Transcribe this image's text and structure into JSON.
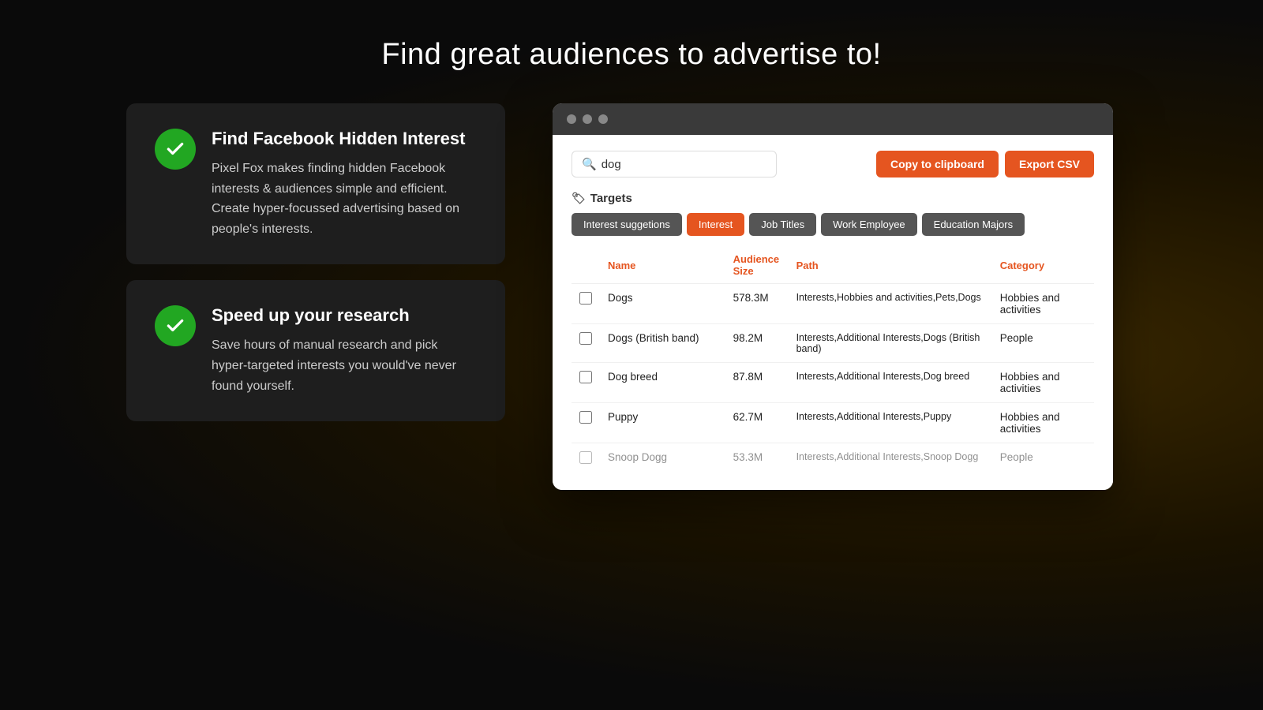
{
  "page": {
    "title": "Find great audiences to advertise to!"
  },
  "features": [
    {
      "id": "feature-1",
      "heading": "Find Facebook Hidden Interest",
      "body": "Pixel Fox makes finding hidden Facebook interests & audiences simple and efficient. Create hyper-focussed advertising based on people's interests."
    },
    {
      "id": "feature-2",
      "heading": "Speed up your research",
      "body": "Save hours of manual research and pick hyper-targeted interests you would've never found yourself."
    }
  ],
  "window": {
    "dots": [
      "dot1",
      "dot2",
      "dot3"
    ]
  },
  "toolbar": {
    "search_value": "dog",
    "copy_label": "Copy to clipboard",
    "export_label": "Export CSV"
  },
  "targets": {
    "label": "Targets",
    "tabs": [
      {
        "id": "interest-suggestions",
        "label": "Interest suggetions",
        "state": "inactive"
      },
      {
        "id": "interest",
        "label": "Interest",
        "state": "active"
      },
      {
        "id": "job-titles",
        "label": "Job Titles",
        "state": "inactive"
      },
      {
        "id": "work-employee",
        "label": "Work Employee",
        "state": "inactive"
      },
      {
        "id": "education-majors",
        "label": "Education Majors",
        "state": "inactive"
      }
    ]
  },
  "table": {
    "columns": [
      {
        "id": "check",
        "label": ""
      },
      {
        "id": "name",
        "label": "Name"
      },
      {
        "id": "size",
        "label": "Audience Size"
      },
      {
        "id": "path",
        "label": "Path"
      },
      {
        "id": "category",
        "label": "Category"
      }
    ],
    "rows": [
      {
        "name": "Dogs",
        "size": "578.3M",
        "path": "Interests,Hobbies and activities,Pets,Dogs",
        "category": "Hobbies and activities",
        "fade": false
      },
      {
        "name": "Dogs (British band)",
        "size": "98.2M",
        "path": "Interests,Additional Interests,Dogs (British band)",
        "category": "People",
        "fade": false
      },
      {
        "name": "Dog breed",
        "size": "87.8M",
        "path": "Interests,Additional Interests,Dog breed",
        "category": "Hobbies and activities",
        "fade": false
      },
      {
        "name": "Puppy",
        "size": "62.7M",
        "path": "Interests,Additional Interests,Puppy",
        "category": "Hobbies and activities",
        "fade": false
      },
      {
        "name": "Snoop Dogg",
        "size": "53.3M",
        "path": "Interests,Additional Interests,Snoop Dogg",
        "category": "People",
        "fade": true
      }
    ]
  }
}
